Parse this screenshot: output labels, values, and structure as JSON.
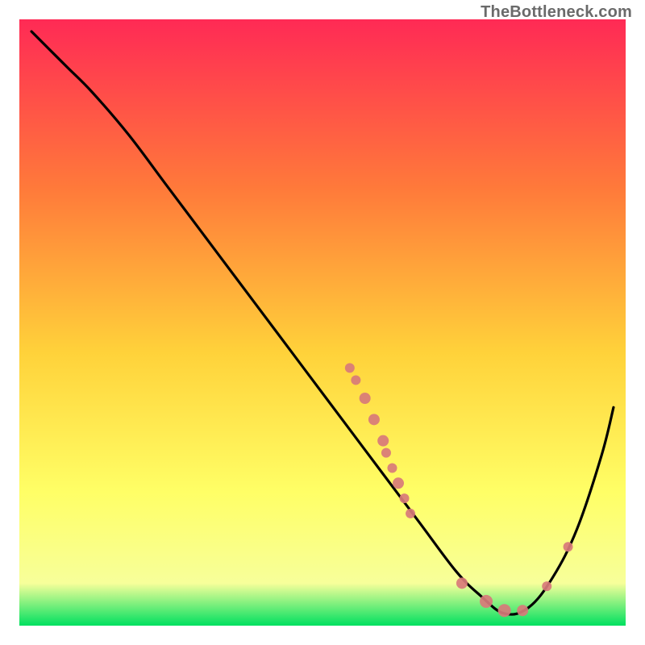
{
  "watermark": "TheBottleneck.com",
  "chart_data": {
    "type": "line",
    "title": "",
    "xlabel": "",
    "ylabel": "",
    "xlim": [
      0,
      100
    ],
    "ylim": [
      0,
      100
    ],
    "background_gradient": {
      "top": "#ff2a55",
      "upper_mid": "#ff7a3a",
      "mid": "#ffd23a",
      "lower_mid": "#ffff66",
      "near_bottom": "#f7ff9a",
      "bottom": "#00e060"
    },
    "series": [
      {
        "name": "curve",
        "type": "line",
        "color": "#000000",
        "x": [
          2,
          5,
          8,
          12,
          18,
          24,
          30,
          36,
          42,
          48,
          54,
          60,
          66,
          72,
          76,
          80,
          84,
          88,
          92,
          96,
          98
        ],
        "y": [
          98,
          95,
          92,
          88,
          81,
          73,
          65,
          57,
          49,
          41,
          33,
          25,
          17,
          9,
          5,
          2,
          3,
          8,
          16,
          28,
          36
        ]
      },
      {
        "name": "markers",
        "type": "scatter",
        "color": "#d87a7a",
        "points": [
          {
            "x": 54.5,
            "y": 42.5,
            "r": 6
          },
          {
            "x": 55.5,
            "y": 40.5,
            "r": 6
          },
          {
            "x": 57.0,
            "y": 37.5,
            "r": 7
          },
          {
            "x": 58.5,
            "y": 34.0,
            "r": 7
          },
          {
            "x": 60.0,
            "y": 30.5,
            "r": 7
          },
          {
            "x": 60.5,
            "y": 28.5,
            "r": 6
          },
          {
            "x": 61.5,
            "y": 26.0,
            "r": 6
          },
          {
            "x": 62.5,
            "y": 23.5,
            "r": 7
          },
          {
            "x": 63.5,
            "y": 21.0,
            "r": 6
          },
          {
            "x": 64.5,
            "y": 18.5,
            "r": 6
          },
          {
            "x": 73.0,
            "y": 7.0,
            "r": 7
          },
          {
            "x": 77.0,
            "y": 4.0,
            "r": 8
          },
          {
            "x": 80.0,
            "y": 2.5,
            "r": 8
          },
          {
            "x": 83.0,
            "y": 2.5,
            "r": 7
          },
          {
            "x": 87.0,
            "y": 6.5,
            "r": 6
          },
          {
            "x": 90.5,
            "y": 13.0,
            "r": 6
          }
        ]
      }
    ]
  }
}
